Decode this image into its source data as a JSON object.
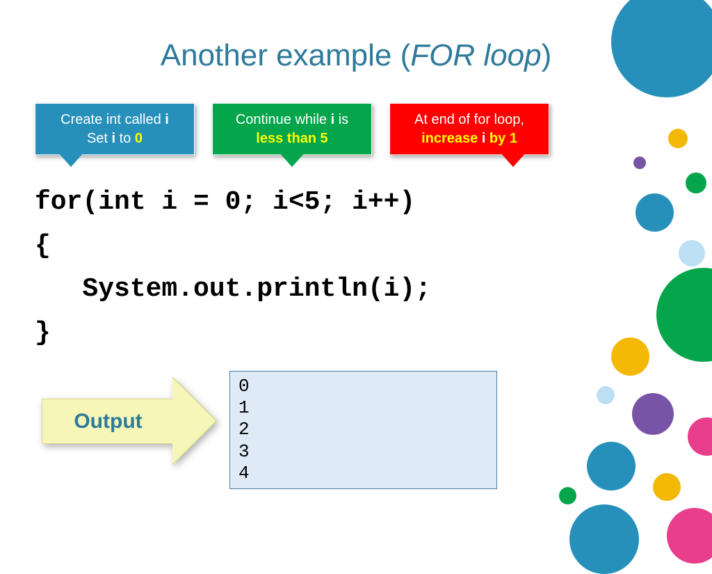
{
  "title": {
    "prefix": "Another example (",
    "italic": "FOR loop",
    "suffix": ")"
  },
  "callouts": {
    "blue": {
      "line1_a": "Create int called ",
      "line1_b": "i",
      "line2_a": "Set ",
      "line2_b": "i",
      "line2_c": " to ",
      "line2_d": "0"
    },
    "green": {
      "line1_a": "Continue while ",
      "line1_b": "i",
      "line1_c": " is",
      "line2": "less than 5"
    },
    "red": {
      "line1": "At end of for loop,",
      "line2_a": "increase ",
      "line2_b": "i",
      "line2_c": " by 1"
    }
  },
  "code": {
    "l1": "for(int i = 0; i<5; i++)",
    "l2": "{",
    "l3": "   System.out.println(i);",
    "l4": "}"
  },
  "output_label": "Output",
  "output_lines": [
    "0",
    "1",
    "2",
    "3",
    "4"
  ]
}
